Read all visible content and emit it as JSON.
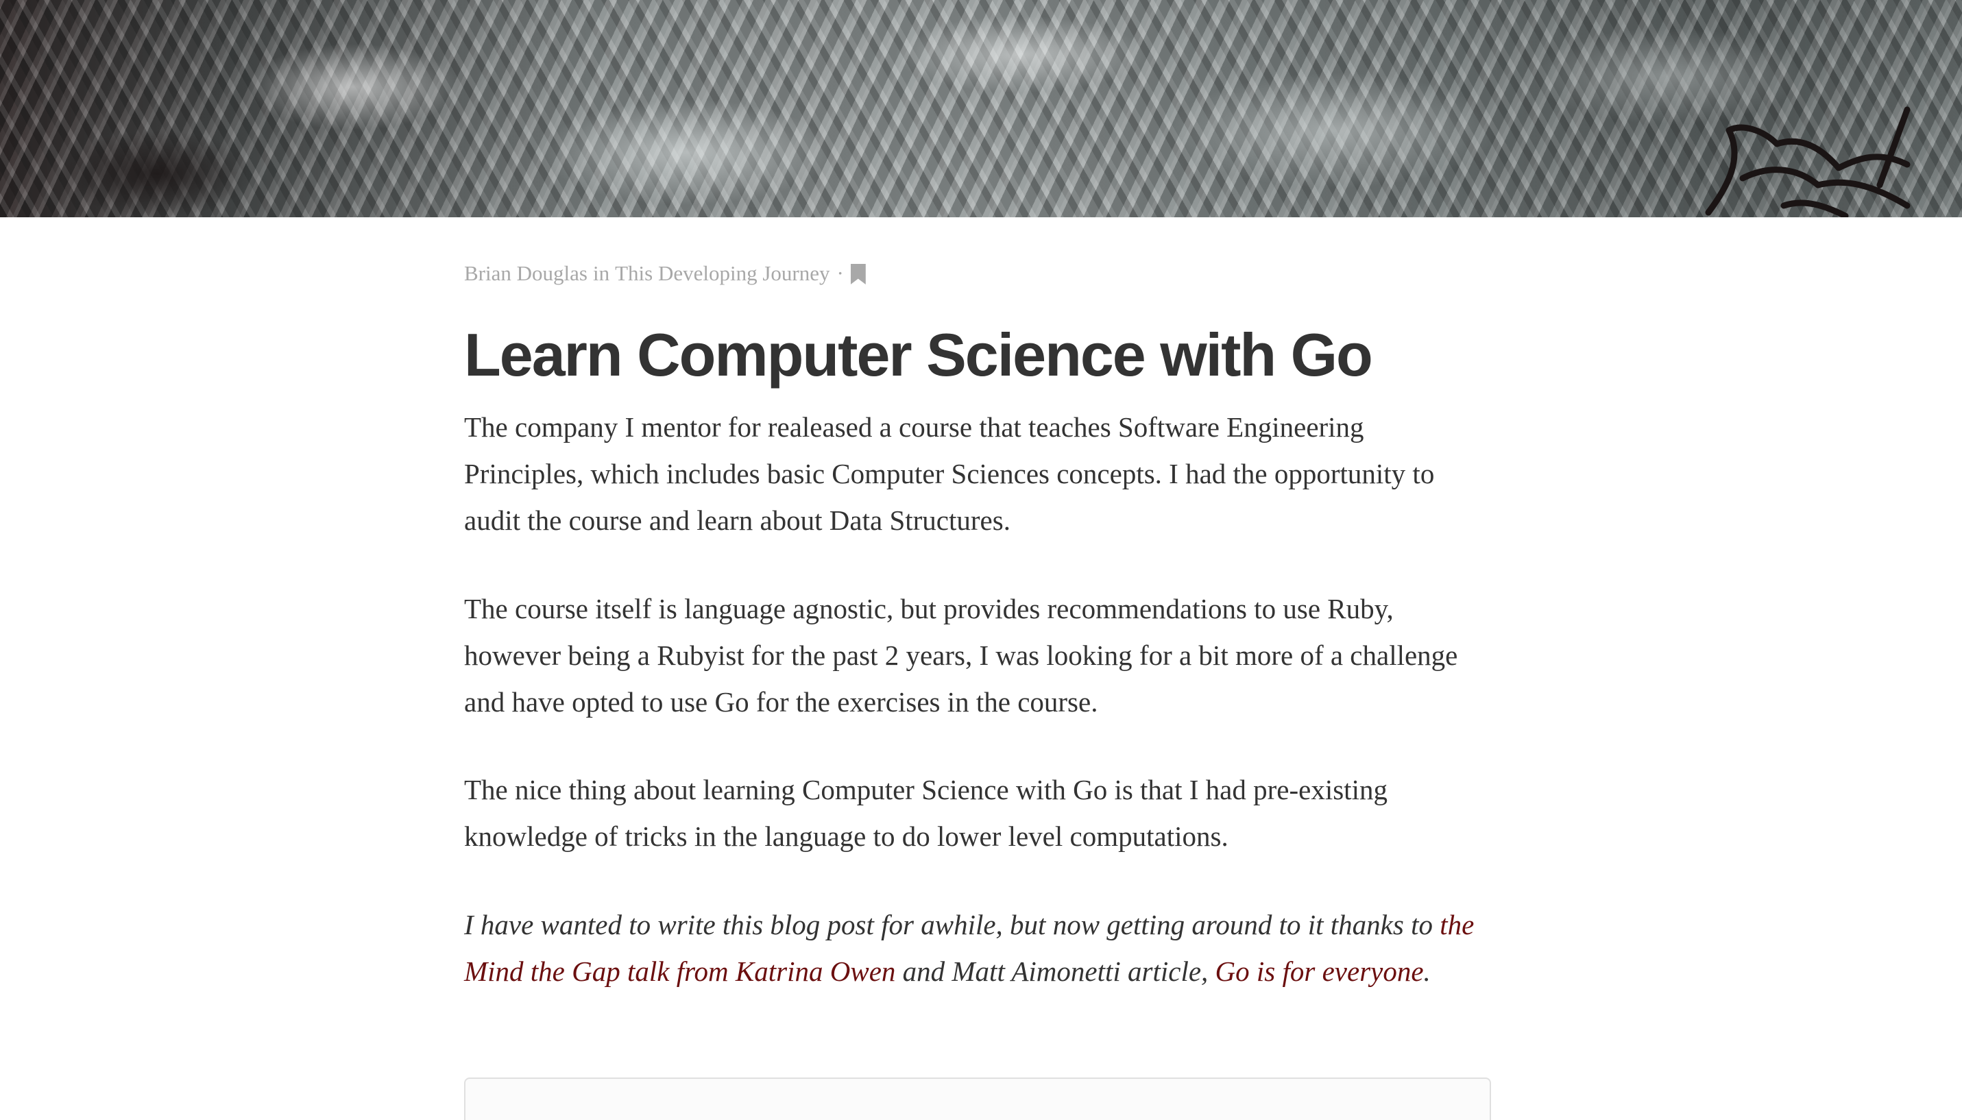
{
  "post": {
    "author": "Brian Douglas",
    "in_word": "in",
    "collection": "This Developing Journey",
    "separator": "·",
    "bookmark_icon": "bookmark-icon",
    "title": "Learn Computer Science with Go",
    "paragraphs": [
      "The company I mentor for realeased a course that teaches Software Engineering Principles, which includes basic Computer Sciences concepts. I had the opportunity to audit the course and learn about Data Structures.",
      "The course itself is language agnostic, but provides recommendations to use Ruby, however being a Rubyist for the past 2 years, I was looking for a bit more of a challenge and have opted to use Go for the exercises in the course.",
      "The nice thing about learning Computer Science with Go is that I had pre-existing knowledge of tricks in the language to do lower level computations."
    ],
    "note": {
      "text_before": "I have wanted to write this blog post for awhile, but now getting around to it thanks to ",
      "link1": "the Mind the Gap talk from Katrina Owen",
      "text_middle": " and Matt Aimonetti article, ",
      "link2": "Go is for everyone",
      "text_after": "."
    }
  },
  "colors": {
    "text": "#333333",
    "meta": "#a8a8a8",
    "link": "#6b0f0f"
  }
}
